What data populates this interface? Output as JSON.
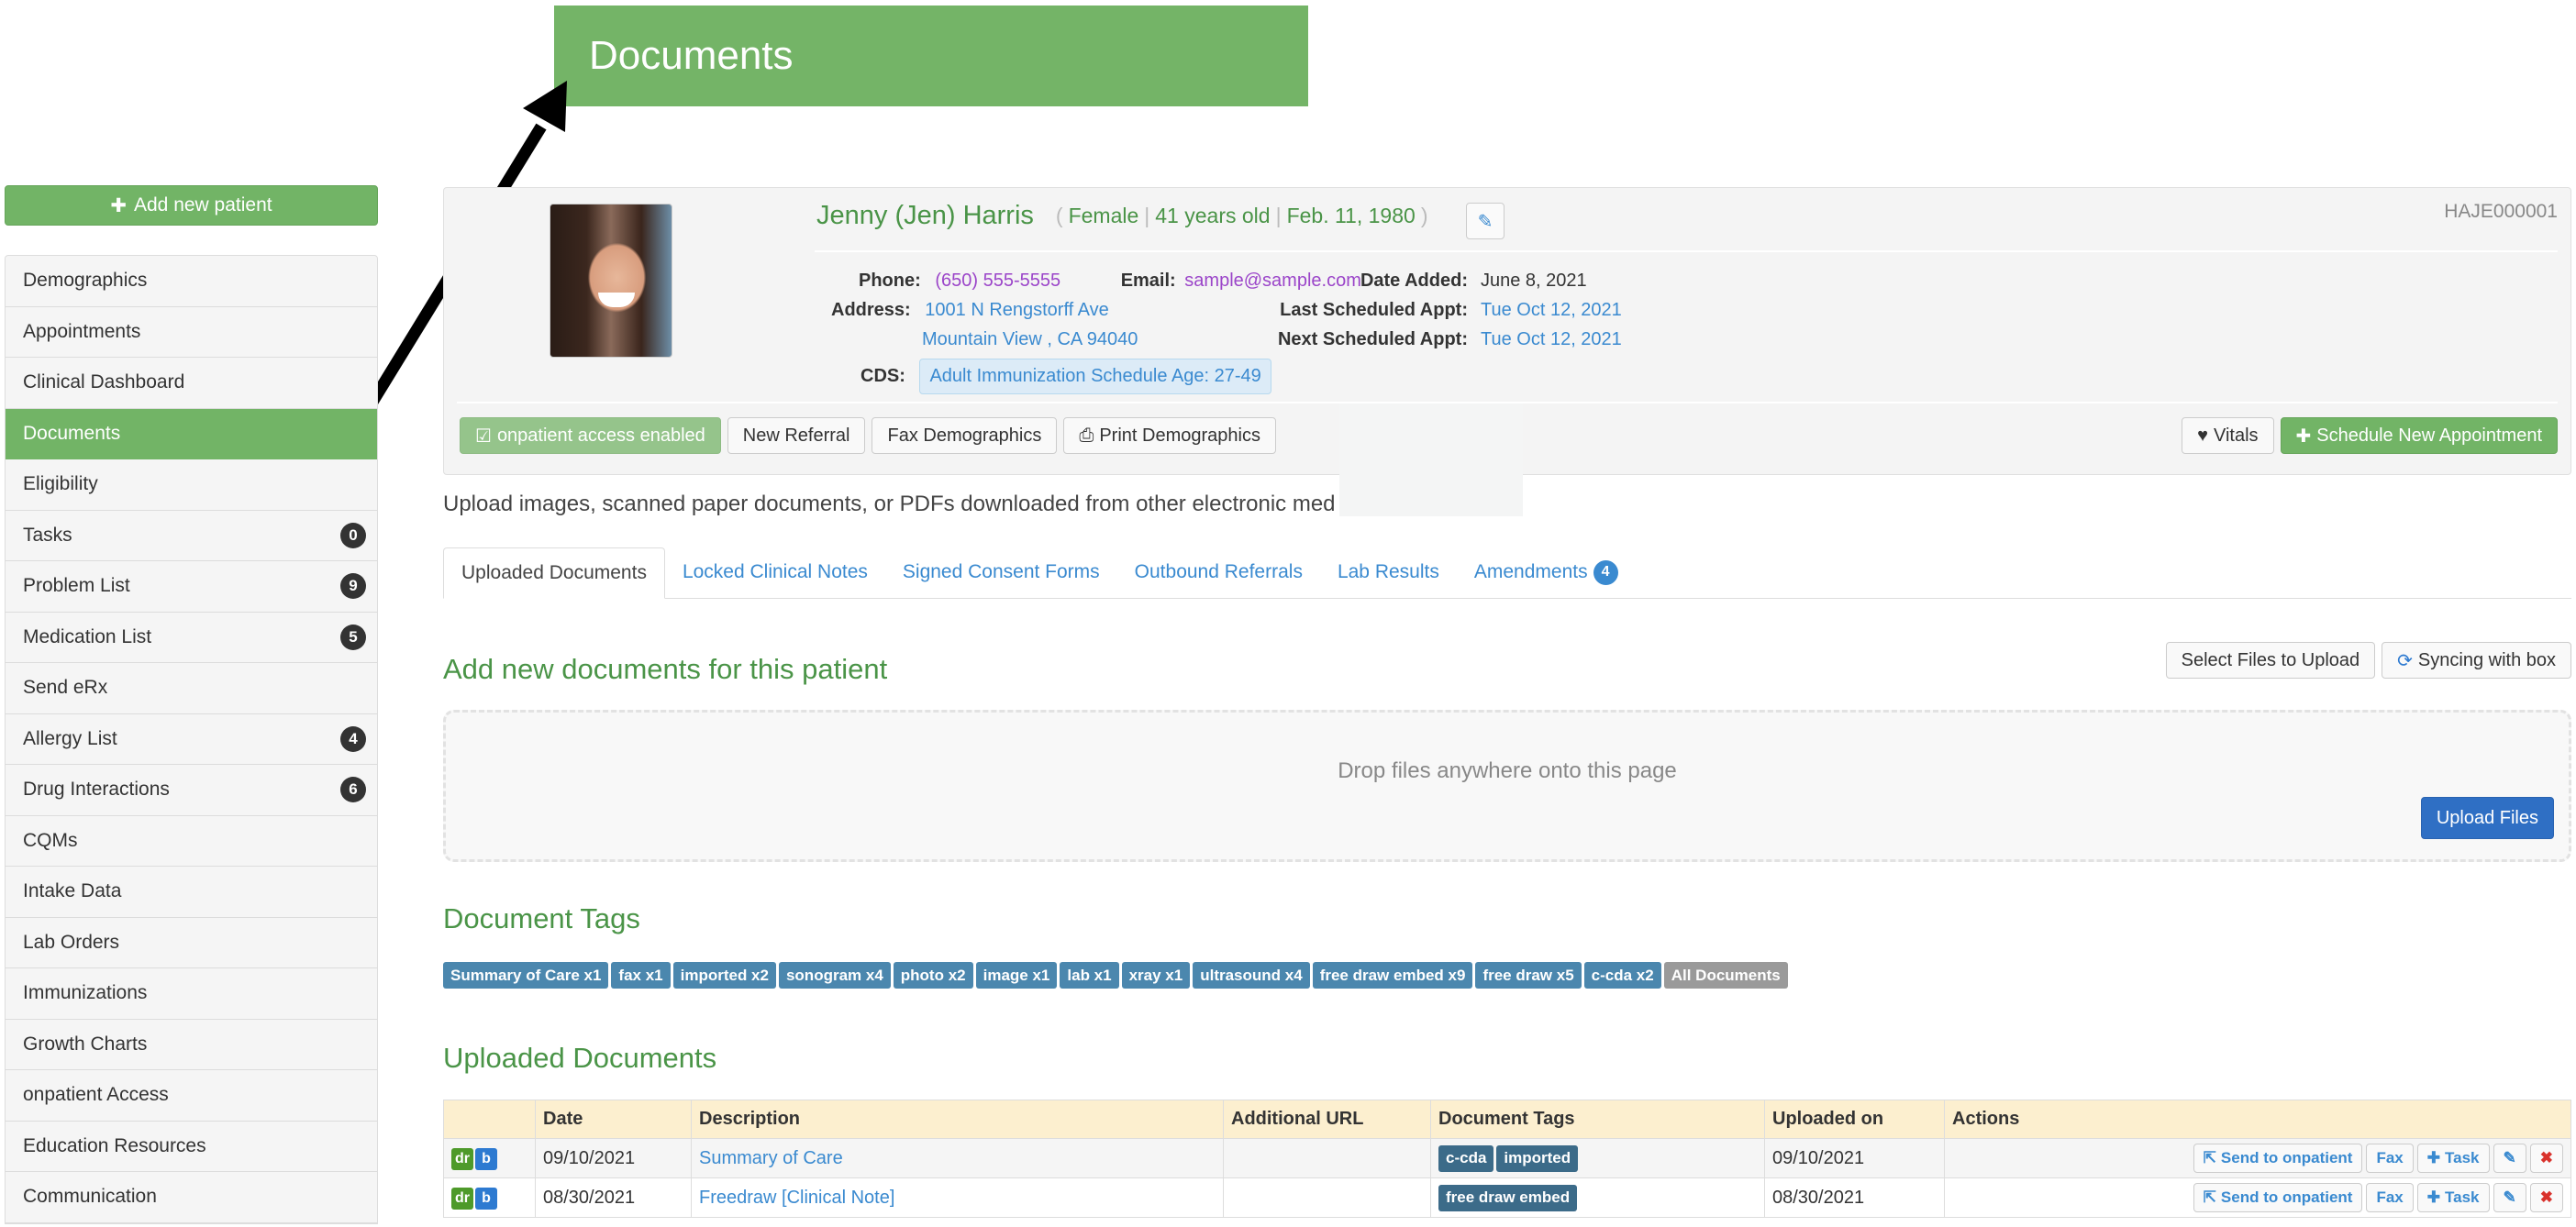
{
  "callout": {
    "title": "Documents"
  },
  "sidebar": {
    "add_patient_label": "Add new patient",
    "items": [
      {
        "label": "Demographics",
        "badge": null,
        "active": false
      },
      {
        "label": "Appointments",
        "badge": null,
        "active": false
      },
      {
        "label": "Clinical Dashboard",
        "badge": null,
        "active": false
      },
      {
        "label": "Documents",
        "badge": null,
        "active": true
      },
      {
        "label": "Eligibility",
        "badge": null,
        "active": false
      },
      {
        "label": "Tasks",
        "badge": "0",
        "active": false
      },
      {
        "label": "Problem List",
        "badge": "9",
        "active": false
      },
      {
        "label": "Medication List",
        "badge": "5",
        "active": false
      },
      {
        "label": "Send eRx",
        "badge": null,
        "active": false
      },
      {
        "label": "Allergy List",
        "badge": "4",
        "active": false
      },
      {
        "label": "Drug Interactions",
        "badge": "6",
        "active": false
      },
      {
        "label": "CQMs",
        "badge": null,
        "active": false
      },
      {
        "label": "Intake Data",
        "badge": null,
        "active": false
      },
      {
        "label": "Lab Orders",
        "badge": null,
        "active": false
      },
      {
        "label": "Immunizations",
        "badge": null,
        "active": false
      },
      {
        "label": "Growth Charts",
        "badge": null,
        "active": false
      },
      {
        "label": "onpatient Access",
        "badge": null,
        "active": false
      },
      {
        "label": "Education Resources",
        "badge": null,
        "active": false
      },
      {
        "label": "Communication",
        "badge": null,
        "active": false
      }
    ]
  },
  "patient": {
    "name": "Jenny (Jen) Harris",
    "gender": "Female",
    "age": "41 years old",
    "dob": "Feb. 11, 1980",
    "id": "HAJE000001",
    "phone_label": "Phone:",
    "phone": "(650) 555-5555",
    "email_label": "Email:",
    "email": "sample@sample.com",
    "address_label": "Address:",
    "address_line1": "1001 N Rengstorff Ave",
    "address_line2": "Mountain View , CA 94040",
    "cds_label": "CDS:",
    "cds": "Adult Immunization Schedule Age: 27-49",
    "date_added_label": "Date Added:",
    "date_added": "June 8, 2021",
    "last_appt_label": "Last Scheduled Appt:",
    "last_appt": "Tue Oct 12, 2021",
    "next_appt_label": "Next Scheduled Appt:",
    "next_appt": "Tue Oct 12, 2021"
  },
  "actions": {
    "onpatient_access": "onpatient access enabled",
    "new_referral": "New Referral",
    "fax_demographics": "Fax Demographics",
    "print_demographics": "Print Demographics",
    "vitals": "Vitals",
    "schedule_appt": "Schedule New Appointment"
  },
  "intro_text": "Upload images, scanned paper documents, or PDFs downloaded from other electronic med",
  "tabs": [
    {
      "label": "Uploaded Documents",
      "active": true,
      "count": null
    },
    {
      "label": "Locked Clinical Notes",
      "active": false,
      "count": null
    },
    {
      "label": "Signed Consent Forms",
      "active": false,
      "count": null
    },
    {
      "label": "Outbound Referrals",
      "active": false,
      "count": null
    },
    {
      "label": "Lab Results",
      "active": false,
      "count": null
    },
    {
      "label": "Amendments",
      "active": false,
      "count": "4"
    }
  ],
  "upload": {
    "heading": "Add new documents for this patient",
    "select_files": "Select Files to Upload",
    "syncing": "Syncing with box",
    "drop_msg": "Drop files anywhere onto this page",
    "upload_files": "Upload Files"
  },
  "document_tags": {
    "heading": "Document Tags",
    "tags": [
      "Summary of Care x1",
      "fax x1",
      "imported x2",
      "sonogram x4",
      "photo x2",
      "image x1",
      "lab x1",
      "xray x1",
      "ultrasound x4",
      "free draw embed x9",
      "free draw x5",
      "c-cda x2"
    ],
    "all_label": "All Documents"
  },
  "uploaded_documents": {
    "heading": "Uploaded Documents",
    "columns": [
      "",
      "Date",
      "Description",
      "Additional URL",
      "Document Tags",
      "Uploaded on",
      "Actions"
    ],
    "rows": [
      {
        "date": "09/10/2021",
        "description": "Summary of Care",
        "url": "",
        "tags": [
          "c-cda",
          "imported"
        ],
        "uploaded_on": "09/10/2021"
      },
      {
        "date": "08/30/2021",
        "description": "Freedraw [Clinical Note]",
        "url": "",
        "tags": [
          "free draw embed"
        ],
        "uploaded_on": "08/30/2021"
      }
    ],
    "row_actions": {
      "send": "Send to onpatient",
      "fax": "Fax",
      "task": "Task"
    },
    "icons": {
      "dr": "dr",
      "b": "b"
    }
  }
}
